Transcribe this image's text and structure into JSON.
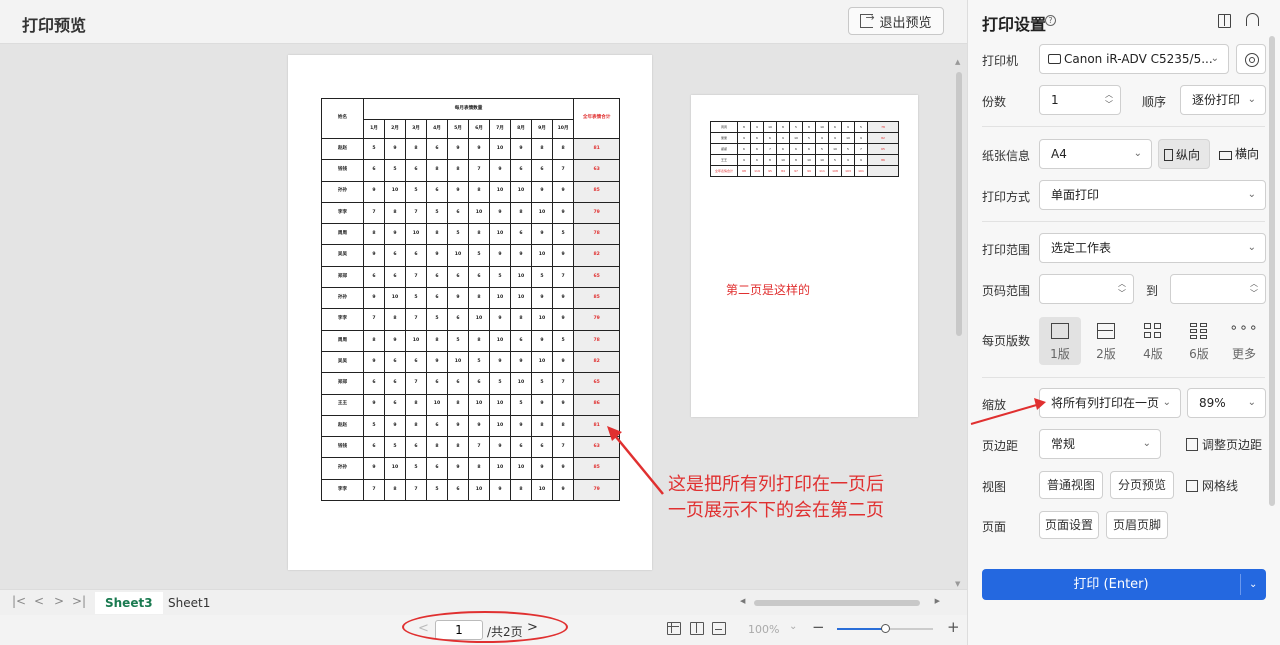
{
  "header": {
    "title": "打印预览",
    "exit_label": "退出预览"
  },
  "sheet_months": [
    "1月",
    "2月",
    "3月",
    "4月",
    "5月",
    "6月",
    "7月",
    "8月",
    "9月",
    "10月"
  ],
  "page1": {
    "name_col": "姓名",
    "group_title": "每月表情数量",
    "total_col": "全年表情合计",
    "rows": [
      [
        "赵赵",
        "5",
        "9",
        "8",
        "6",
        "9",
        "9",
        "10",
        "9",
        "8",
        "8",
        "81"
      ],
      [
        "钱钱",
        "6",
        "5",
        "6",
        "8",
        "8",
        "7",
        "9",
        "6",
        "6",
        "7",
        "63"
      ],
      [
        "孙孙",
        "9",
        "10",
        "5",
        "6",
        "9",
        "8",
        "10",
        "10",
        "9",
        "9",
        "85"
      ],
      [
        "李李",
        "7",
        "8",
        "7",
        "5",
        "6",
        "10",
        "9",
        "8",
        "10",
        "9",
        "79"
      ],
      [
        "周周",
        "8",
        "9",
        "10",
        "8",
        "5",
        "8",
        "10",
        "6",
        "9",
        "5",
        "78"
      ],
      [
        "吴吴",
        "9",
        "6",
        "6",
        "9",
        "10",
        "5",
        "9",
        "9",
        "10",
        "9",
        "82"
      ],
      [
        "郑郑",
        "6",
        "6",
        "7",
        "6",
        "6",
        "6",
        "5",
        "10",
        "5",
        "7",
        "65"
      ],
      [
        "孙孙",
        "9",
        "10",
        "5",
        "6",
        "9",
        "8",
        "10",
        "10",
        "9",
        "9",
        "85"
      ],
      [
        "李李",
        "7",
        "8",
        "7",
        "5",
        "6",
        "10",
        "9",
        "8",
        "10",
        "9",
        "79"
      ],
      [
        "周周",
        "8",
        "9",
        "10",
        "8",
        "5",
        "8",
        "10",
        "6",
        "9",
        "5",
        "78"
      ],
      [
        "吴吴",
        "9",
        "6",
        "6",
        "9",
        "10",
        "5",
        "9",
        "9",
        "10",
        "9",
        "82"
      ],
      [
        "郑郑",
        "6",
        "6",
        "7",
        "6",
        "6",
        "6",
        "5",
        "10",
        "5",
        "7",
        "65"
      ],
      [
        "王王",
        "9",
        "6",
        "8",
        "10",
        "8",
        "10",
        "10",
        "5",
        "9",
        "9",
        "86"
      ],
      [
        "赵赵",
        "5",
        "9",
        "8",
        "6",
        "9",
        "9",
        "10",
        "9",
        "8",
        "8",
        "81"
      ],
      [
        "钱钱",
        "6",
        "5",
        "6",
        "8",
        "8",
        "7",
        "9",
        "6",
        "6",
        "7",
        "63"
      ],
      [
        "孙孙",
        "9",
        "10",
        "5",
        "6",
        "9",
        "8",
        "10",
        "10",
        "9",
        "9",
        "85"
      ],
      [
        "李李",
        "7",
        "8",
        "7",
        "5",
        "6",
        "10",
        "9",
        "8",
        "10",
        "9",
        "79"
      ]
    ]
  },
  "page2": {
    "rows": [
      [
        "周周",
        "8",
        "9",
        "10",
        "8",
        "5",
        "8",
        "10",
        "6",
        "9",
        "5",
        "78"
      ],
      [
        "吴吴",
        "9",
        "6",
        "6",
        "9",
        "10",
        "5",
        "9",
        "9",
        "10",
        "9",
        "82"
      ],
      [
        "郑郑",
        "6",
        "6",
        "7",
        "6",
        "6",
        "6",
        "5",
        "10",
        "5",
        "7",
        "65"
      ],
      [
        "王王",
        "9",
        "6",
        "8",
        "10",
        "8",
        "10",
        "10",
        "5",
        "9",
        "9",
        "86"
      ]
    ],
    "sum_row": [
      "全年表情合计",
      "68",
      "119",
      "95",
      "84",
      "97",
      "99",
      "111",
      "108",
      "103",
      "101",
      ""
    ],
    "note": "第二页是这样的"
  },
  "annotation": {
    "line1": "这是把所有列打印在一页后",
    "line2": "一页展示不下的会在第二页"
  },
  "sheet_tabs": [
    "Sheet3",
    "Sheet1"
  ],
  "nav_icons": [
    "first-sheet-icon",
    "prev-sheet-icon",
    "next-sheet-icon",
    "last-sheet-icon"
  ],
  "status": {
    "page_value": "1",
    "page_total": "/共2页",
    "zoom_percent": "100%",
    "zoom_level": 0.5
  },
  "panel": {
    "title": "打印设置",
    "printer_label": "打印机",
    "printer_value": "Canon iR-ADV C5235/5...",
    "copies_label": "份数",
    "copies_value": "1",
    "order_label": "顺序",
    "order_value": "逐份打印",
    "paper_label": "纸张信息",
    "paper_value": "A4",
    "portrait_label": "纵向",
    "landscape_label": "横向",
    "mode_label": "打印方式",
    "mode_value": "单面打印",
    "range_label": "打印范围",
    "range_value": "选定工作表",
    "pages_label": "页码范围",
    "to_label": "到",
    "nup_label": "每页版数",
    "nup_options": [
      "1版",
      "2版",
      "4版",
      "6版",
      "更多"
    ],
    "scale_label": "缩放",
    "scale_value": "将所有列打印在一页",
    "scale_pct": "89%",
    "margin_label": "页边距",
    "margin_value": "常规",
    "margin_adjust": "调整页边距",
    "view_label": "视图",
    "view_normal": "普通视图",
    "view_break": "分页预览",
    "gridlines": "网格线",
    "page_label": "页面",
    "page_setup": "页面设置",
    "header_footer": "页眉页脚",
    "print_button": "打印 (Enter)"
  },
  "colors": {
    "accent": "#2468e0",
    "annotation": "#e03030",
    "active_tab": "#1a7a50"
  }
}
